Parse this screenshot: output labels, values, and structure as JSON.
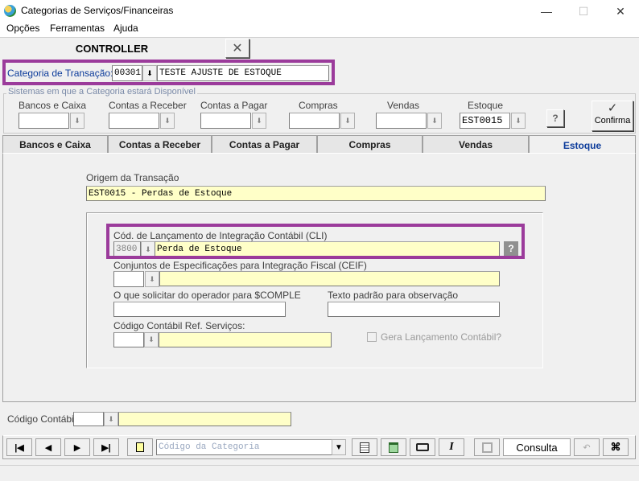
{
  "window": {
    "title": "Categorias de Serviços/Financeiras",
    "minimize": "—",
    "maximize": "☐",
    "close": "✕"
  },
  "menu": [
    "Opções",
    "Ferramentas",
    "Ajuda"
  ],
  "header": {
    "module": "CONTROLLER",
    "close_glyph": "✕"
  },
  "categoria": {
    "label": "Categoria de Transação:",
    "code": "00301",
    "description": "TESTE AJUSTE DE ESTOQUE"
  },
  "sistemas": {
    "group_label": "Sistemas em que a Categoria estará Disponível",
    "items": [
      {
        "label": "Bancos e Caixa",
        "value": ""
      },
      {
        "label": "Contas a Receber",
        "value": ""
      },
      {
        "label": "Contas a Pagar",
        "value": ""
      },
      {
        "label": "Compras",
        "value": ""
      },
      {
        "label": "Vendas",
        "value": ""
      },
      {
        "label": "Estoque",
        "value": "EST0015"
      }
    ],
    "help_glyph": "?",
    "confirm_label": "Confirma",
    "confirm_glyph": "✓"
  },
  "tabs": [
    "Bancos e Caixa",
    "Contas a Receber",
    "Contas a Pagar",
    "Compras",
    "Vendas",
    "Estoque"
  ],
  "estoque": {
    "origem_label": "Origem da Transação",
    "origem_value": "EST0015 - Perdas de Estoque",
    "cli_label": "Cód. de Lançamento de Integração Contábil (CLI)",
    "cli_code": "3800",
    "cli_description": "Perda de Estoque",
    "ceif_label": "Conjuntos de Especificações para Integração Fiscal (CEIF)",
    "ceif_code": "",
    "ceif_description": "",
    "comple_label": "O que solicitar do operador para $COMPLE",
    "comple_value": "",
    "obs_label": "Texto padrão para observação",
    "obs_value": "",
    "cod_ref_label": "Código Contábil Ref. Serviços:",
    "cod_ref_code": "",
    "cod_ref_description": "",
    "gera_label": "Gera Lançamento Contábil?"
  },
  "footer": {
    "codigo_contabil_label": "Código Contábil:",
    "codigo_contabil_code": "",
    "codigo_contabil_description": ""
  },
  "toolbar": {
    "search_placeholder": "Código da Categoria",
    "mode": "Consulta",
    "first_glyph": "|◀",
    "prev_glyph": "◀",
    "next_glyph": "▶",
    "last_glyph": "▶|",
    "find_glyph": "🔭"
  },
  "colors": {
    "highlight": "#9b3b9b",
    "accent_blue": "#0a3a9a",
    "field_yellow": "#ffffc8"
  }
}
